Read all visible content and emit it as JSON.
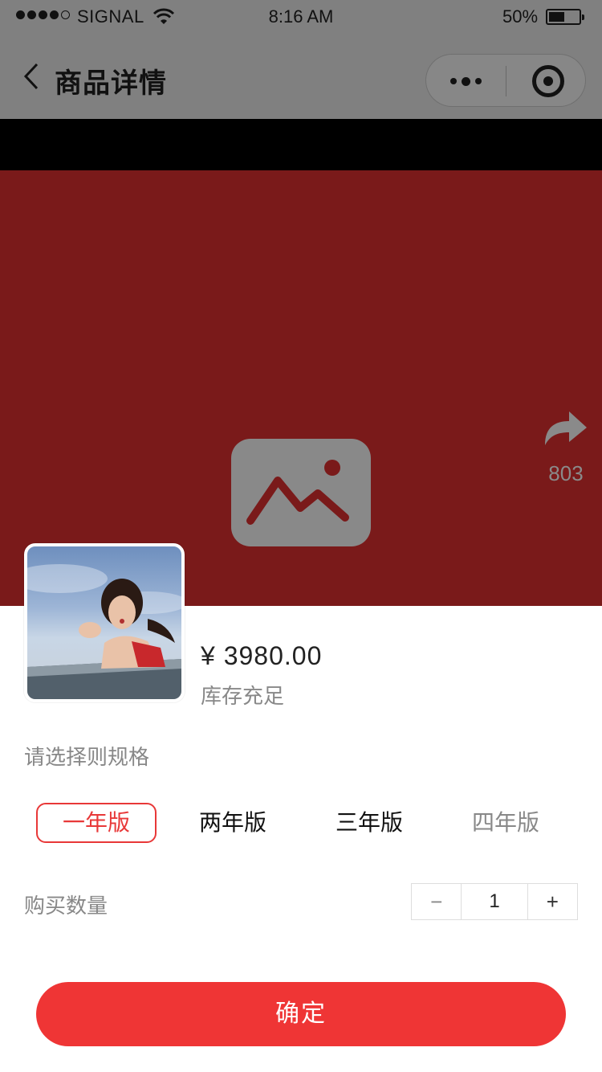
{
  "status_bar": {
    "carrier": "SIGNAL",
    "time": "8:16 AM",
    "battery": "50%",
    "signal_bars": 4,
    "battery_level": 0.5
  },
  "nav": {
    "title": "商品详情",
    "back_icon": "chevron-left-icon",
    "more_icon": "more-dots-icon",
    "target_icon": "target-icon"
  },
  "banner": {
    "placeholder_icon": "image-placeholder-icon",
    "share_icon": "share-arrow-icon",
    "share_count": "803",
    "background_color": "#7a1a1a"
  },
  "sku": {
    "price": "¥ 3980.00",
    "stock": "库存充足",
    "spec_label": "请选择则规格",
    "options": [
      {
        "label": "一年版",
        "state": "selected"
      },
      {
        "label": "两年版",
        "state": "normal"
      },
      {
        "label": "三年版",
        "state": "normal"
      },
      {
        "label": "四年版",
        "state": "disabled"
      }
    ],
    "quantity_label": "购买数量",
    "quantity": "1",
    "minus": "−",
    "plus": "+",
    "confirm": "确定"
  },
  "colors": {
    "accent": "#ef3535",
    "selected_border": "#e83838",
    "nav_overlay": "#808080"
  }
}
